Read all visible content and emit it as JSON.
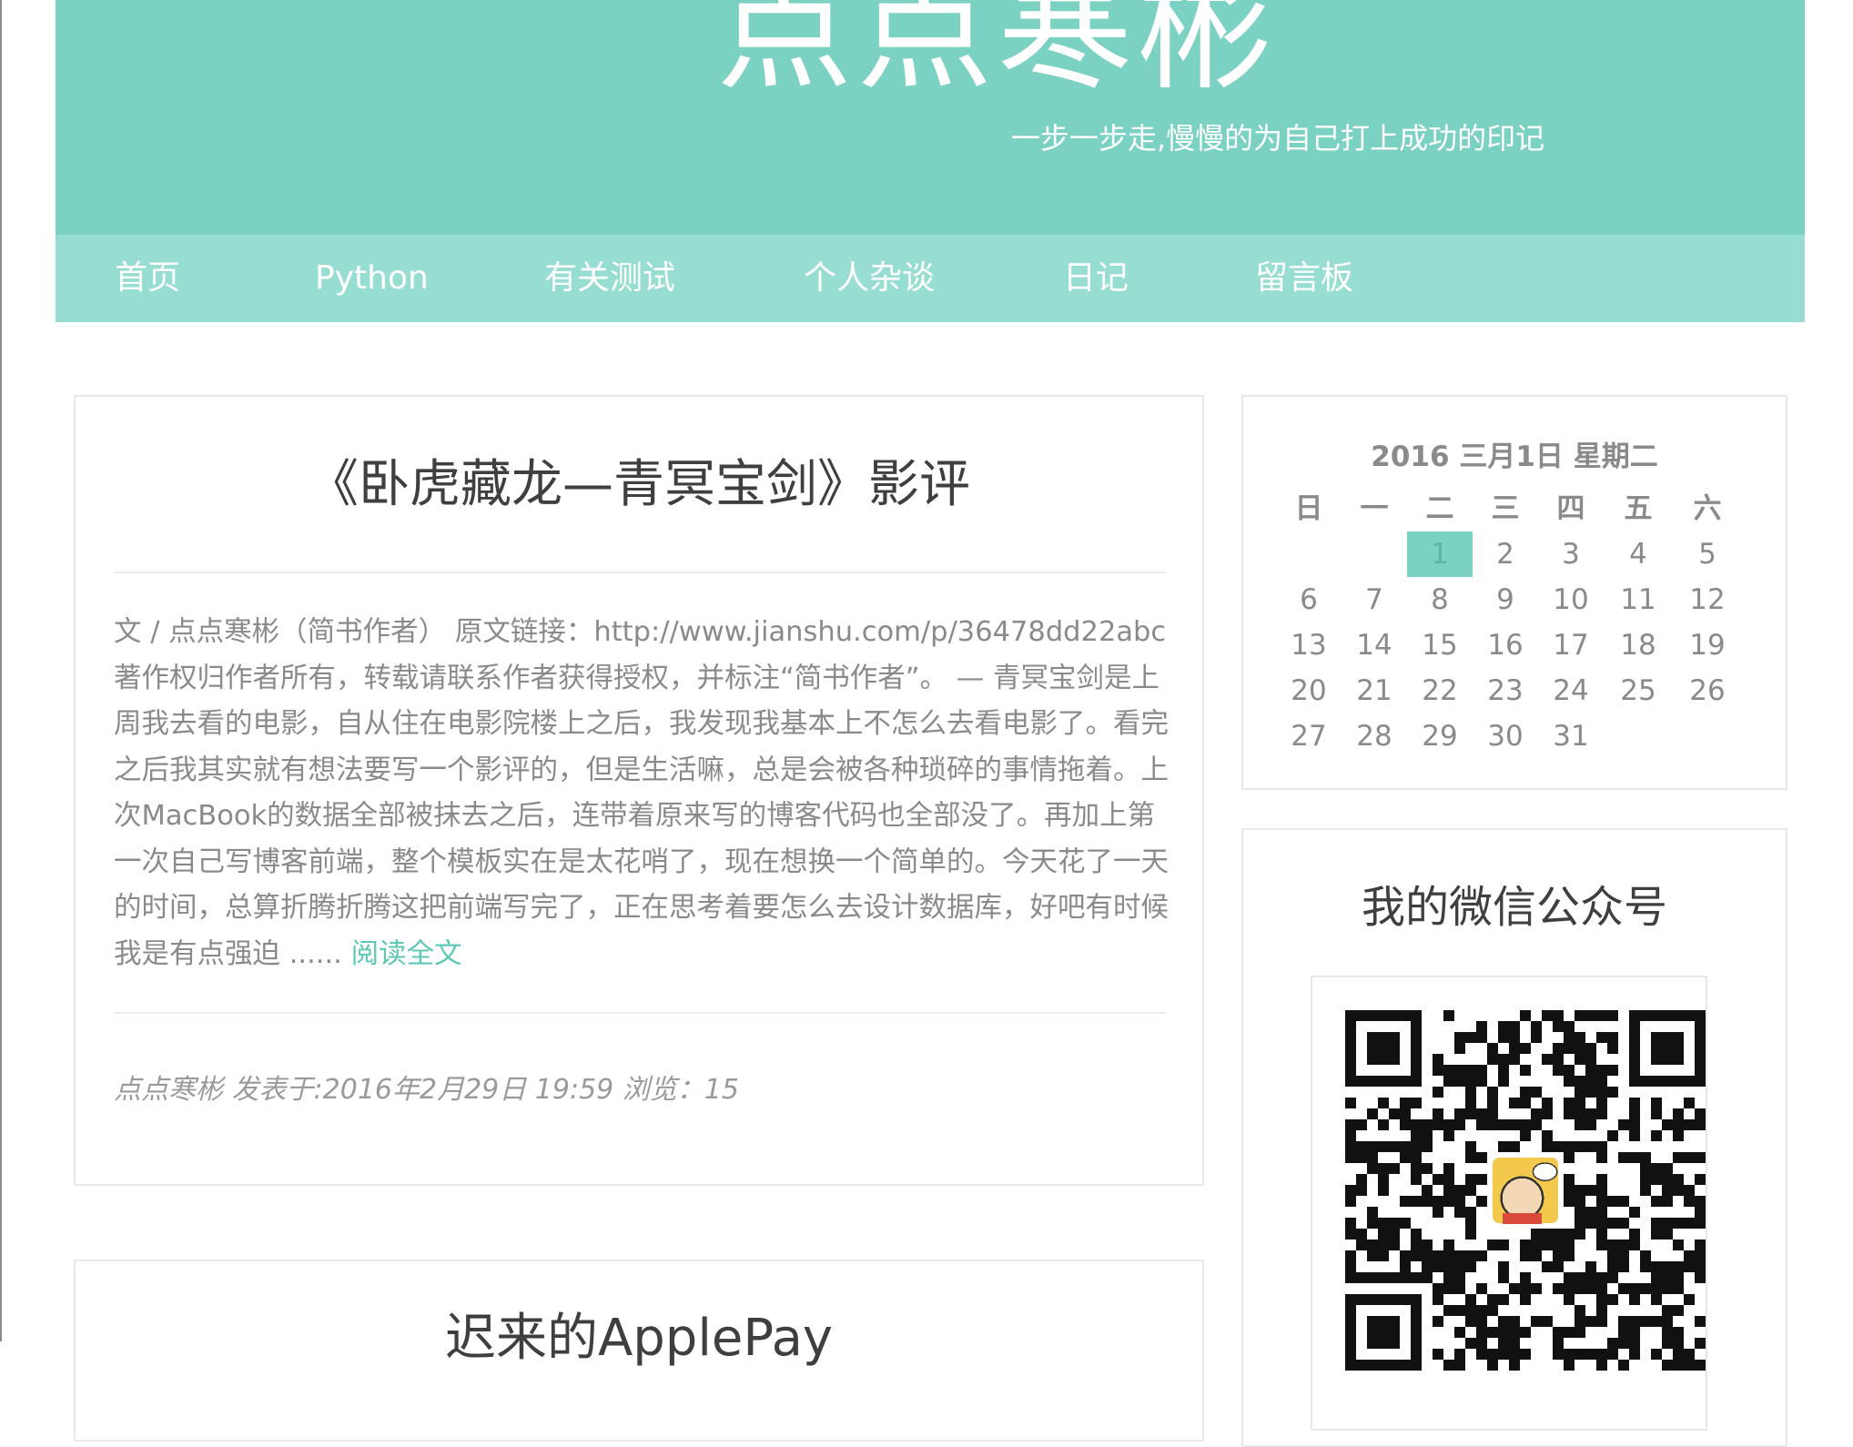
{
  "header": {
    "site_title": "点点寒彬",
    "slogan": "一步一步走,慢慢的为自己打上成功的印记"
  },
  "nav": {
    "items": [
      "首页",
      "Python",
      "有关测试",
      "个人杂谈",
      "日记",
      "留言板"
    ]
  },
  "posts": [
    {
      "title": "《卧虎藏龙—青冥宝剑》影评",
      "excerpt": "文 / 点点寒彬（简书作者） 原文链接：http://www.jianshu.com/p/36478dd22abc 著作权归作者所有，转载请联系作者获得授权，并标注“简书作者”。 — 青冥宝剑是上周我去看的电影，自从住在电影院楼上之后，我发现我基本上不怎么去看电影了。看完之后我其实就有想法要写一个影评的，但是生活嘛，总是会被各种琐碎的事情拖着。上次MacBook的数据全部被抹去之后，连带着原来写的博客代码也全部没了。再加上第一次自己写博客前端，整个模板实在是太花哨了，现在想换一个简单的。今天花了一天的时间，总算折腾折腾这把前端写完了，正在思考着要怎么去设计数据库，好吧有时候我是有点强迫 ......",
      "read_more": "阅读全文",
      "meta": "点点寒彬 发表于:2016年2月29日 19:59 浏览：15"
    },
    {
      "title": "迟来的ApplePay"
    }
  ],
  "calendar": {
    "caption": "2016 三月1日 星期二",
    "weekdays": [
      "日",
      "一",
      "二",
      "三",
      "四",
      "五",
      "六"
    ],
    "first_weekday_index": 2,
    "days_in_month": 31,
    "today": 1
  },
  "wechat": {
    "title": "我的微信公众号"
  },
  "colors": {
    "header_bg": "#7bd1c2",
    "nav_bg": "#98ddd1",
    "accent": "#5ec8b4"
  }
}
